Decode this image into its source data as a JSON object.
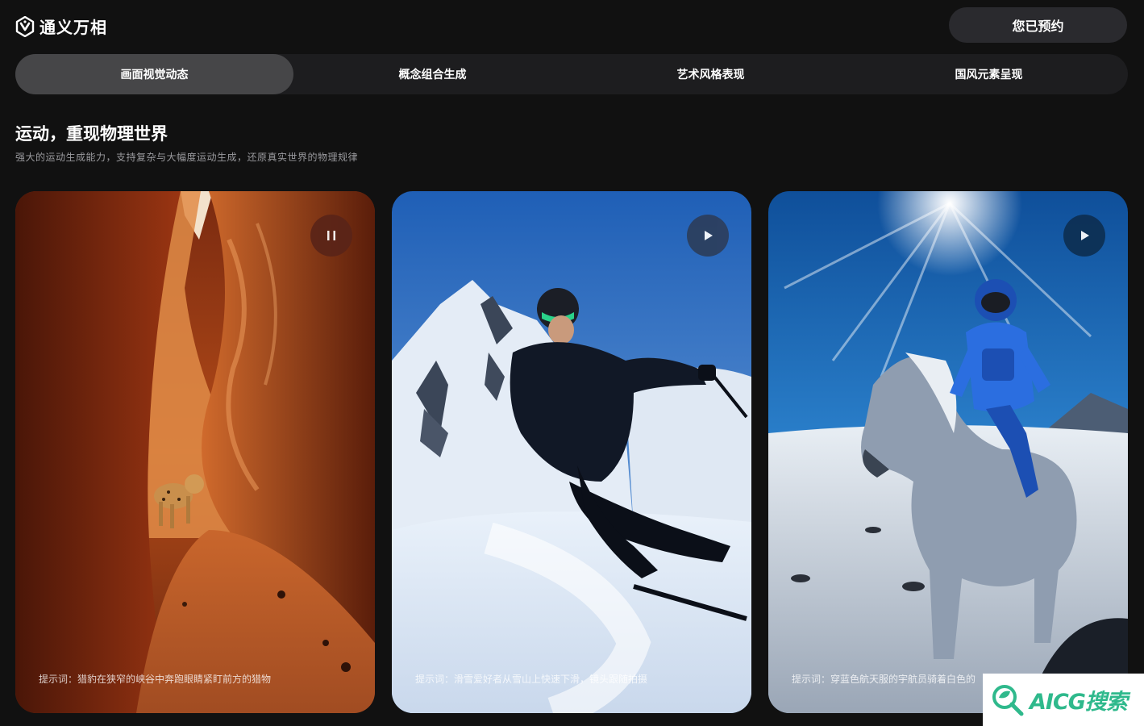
{
  "app": {
    "name": "通义万相"
  },
  "header": {
    "reserve_label": "您已预约"
  },
  "tabs": [
    {
      "label": "画面视觉动态",
      "active": true
    },
    {
      "label": "概念组合生成",
      "active": false
    },
    {
      "label": "艺术风格表现",
      "active": false
    },
    {
      "label": "国风元素呈现",
      "active": false
    }
  ],
  "section": {
    "title": "运动，重现物理世界",
    "description": "强大的运动生成能力，支持复杂与大幅度运动生成，还原真实世界的物理规律"
  },
  "cards": [
    {
      "caption": "提示词：猎豹在狭窄的峡谷中奔跑眼睛紧盯前方的猎物",
      "state": "playing",
      "control_icon": "pause-icon",
      "control_color": "#5a2418"
    },
    {
      "caption": "提示词：滑雪爱好者从雪山上快速下滑，镜头跟随拍摄",
      "state": "paused",
      "control_icon": "play-icon",
      "control_color": "#2c3e5c"
    },
    {
      "caption": "提示词：穿蓝色航天服的宇航员骑着白色的",
      "state": "paused",
      "control_icon": "play-icon",
      "control_color": "#0d2f52"
    }
  ],
  "watermark": {
    "text": "AICG搜索",
    "color": "#2fb98c"
  }
}
